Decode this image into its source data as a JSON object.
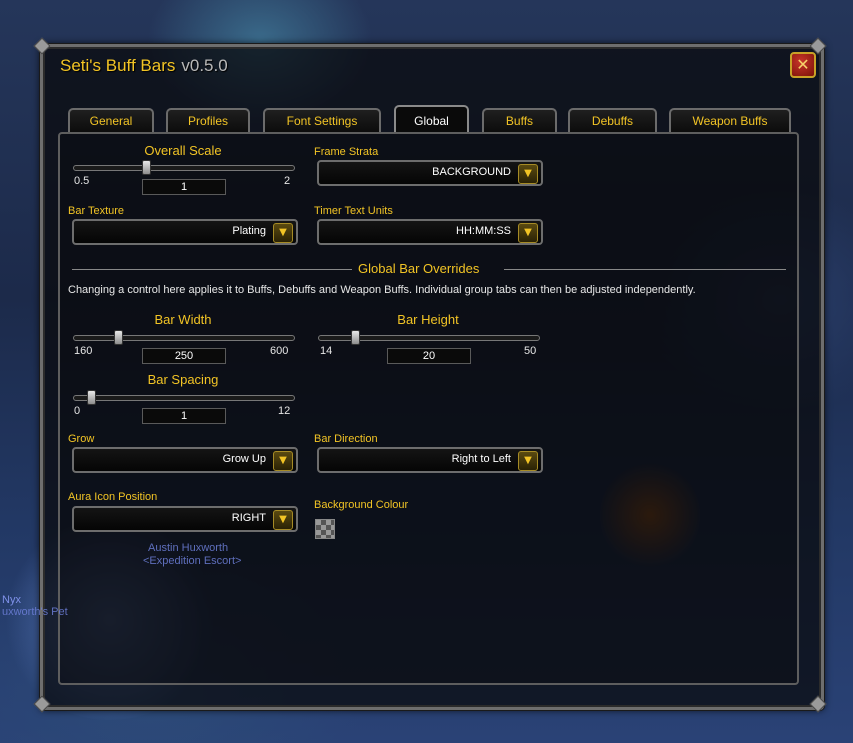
{
  "window": {
    "title": "Seti's Buff Bars",
    "version": "v0.5.0",
    "close_glyph": "✕"
  },
  "tabs": [
    {
      "label": "General"
    },
    {
      "label": "Profiles"
    },
    {
      "label": "Font Settings"
    },
    {
      "label": "Global",
      "active": true
    },
    {
      "label": "Buffs"
    },
    {
      "label": "Debuffs"
    },
    {
      "label": "Weapon Buffs"
    }
  ],
  "overall_scale": {
    "label": "Overall Scale",
    "min": "0.5",
    "max": "2",
    "value": "1",
    "fraction": 0.333
  },
  "frame_strata": {
    "label": "Frame Strata",
    "value": "BACKGROUND"
  },
  "bar_texture": {
    "label": "Bar Texture",
    "value": "Plating"
  },
  "timer_text_units": {
    "label": "Timer Text Units",
    "value": "HH:MM:SS"
  },
  "overrides": {
    "title": "Global Bar Overrides",
    "description": "Changing a control here applies it to Buffs, Debuffs and Weapon Buffs. Individual group tabs can then be adjusted independently."
  },
  "bar_width": {
    "label": "Bar Width",
    "min": "160",
    "max": "600",
    "value": "250",
    "fraction": 0.205
  },
  "bar_height": {
    "label": "Bar Height",
    "min": "14",
    "max": "50",
    "value": "20",
    "fraction": 0.167
  },
  "bar_spacing": {
    "label": "Bar Spacing",
    "min": "0",
    "max": "12",
    "value": "1",
    "fraction": 0.083
  },
  "grow": {
    "label": "Grow",
    "value": "Grow Up"
  },
  "bar_direction": {
    "label": "Bar Direction",
    "value": "Right to Left"
  },
  "aura_icon_position": {
    "label": "Aura Icon Position",
    "value": "RIGHT"
  },
  "background_colour": {
    "label": "Background Colour"
  },
  "dropdown_glyph": "▼",
  "background_text": {
    "npc_name": "Austin Huxworth",
    "npc_title": "<Expedition Escort>",
    "left_name": "Nyx",
    "left_sub": "uxworth's Pet"
  },
  "colors": {
    "accent": "#f2c425",
    "border": "#6e6e6e"
  }
}
